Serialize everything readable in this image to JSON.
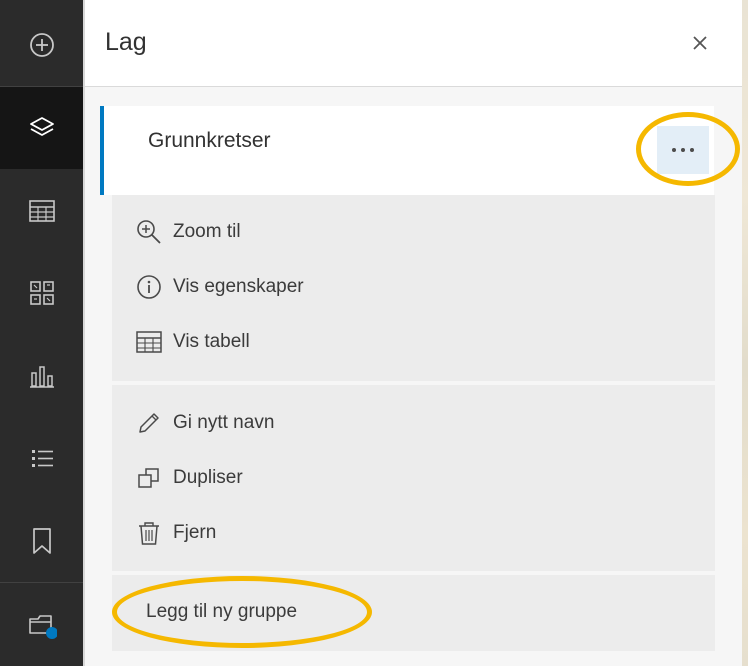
{
  "rail": {
    "items": [
      {
        "id": "add",
        "icon": "plus-circle-icon"
      },
      {
        "id": "layers",
        "icon": "layers-icon",
        "active": true
      },
      {
        "id": "table",
        "icon": "table-icon"
      },
      {
        "id": "widgets",
        "icon": "grid-widgets-icon"
      },
      {
        "id": "chart",
        "icon": "bar-chart-icon"
      },
      {
        "id": "legend",
        "icon": "list-icon"
      },
      {
        "id": "bookmark",
        "icon": "bookmark-icon"
      },
      {
        "id": "basemap",
        "icon": "folder-status-icon",
        "badge_color": "#0079c1"
      }
    ]
  },
  "panel": {
    "title": "Lag",
    "close_icon": "close-icon"
  },
  "layer": {
    "name": "Grunnkretser",
    "accent_color": "#0079c1",
    "more_icon": "ellipsis-icon"
  },
  "menu": {
    "group1": [
      {
        "label": "Zoom til",
        "icon": "zoom-in-icon"
      },
      {
        "label": "Vis egenskaper",
        "icon": "info-icon"
      },
      {
        "label": "Vis tabell",
        "icon": "table-icon"
      }
    ],
    "group2": [
      {
        "label": "Gi nytt navn",
        "icon": "pencil-icon"
      },
      {
        "label": "Dupliser",
        "icon": "duplicate-icon"
      },
      {
        "label": "Fjern",
        "icon": "trash-icon"
      }
    ],
    "add_group_label": "Legg til ny gruppe"
  },
  "annotations": {
    "highlight_color": "#f5b800"
  }
}
